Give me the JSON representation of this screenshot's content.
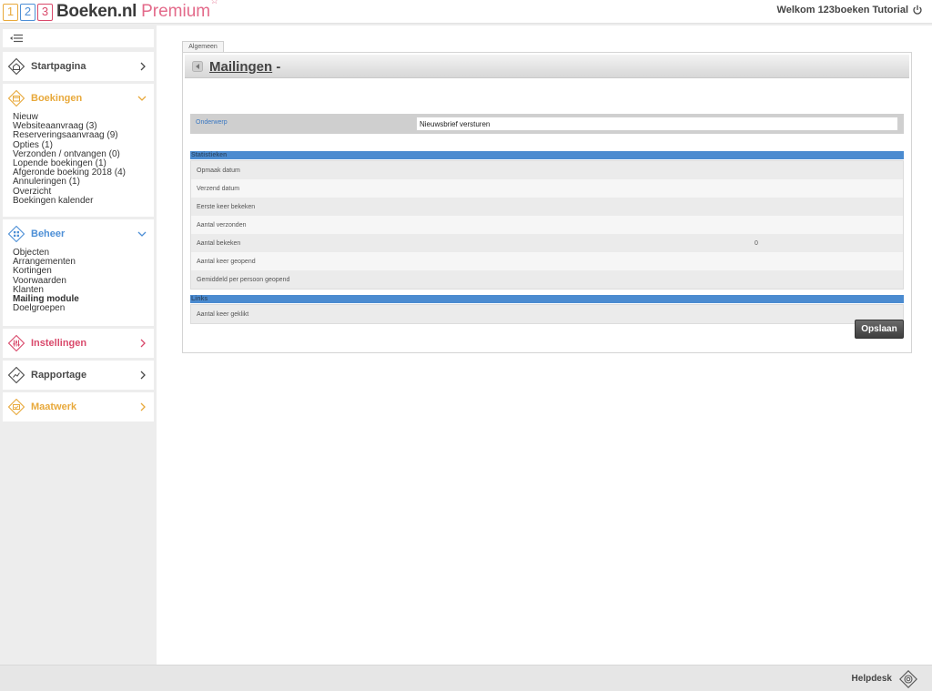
{
  "header": {
    "logo_digits": [
      "1",
      "2",
      "3"
    ],
    "brand": "Boeken.nl",
    "premium": "Premium",
    "premium_star": "☆",
    "welcome": "Welkom 123boeken Tutorial"
  },
  "sidebar": {
    "startpagina": "Startpagina",
    "boekingen": {
      "title": "Boekingen",
      "items": [
        "Nieuw",
        "Websiteaanvraag (3)",
        "Reserveringsaanvraag (9)",
        "Opties (1)",
        "Verzonden / ontvangen (0)",
        "Lopende boekingen (1)",
        "Afgeronde boeking 2018 (4)",
        "Annuleringen (1)",
        "Overzicht",
        "Boekingen kalender"
      ]
    },
    "beheer": {
      "title": "Beheer",
      "items": [
        "Objecten",
        "Arrangementen",
        "Kortingen",
        "Voorwaarden",
        "Klanten",
        "Mailing module",
        "Doelgroepen"
      ],
      "active": "Mailing module"
    },
    "instellingen": "Instellingen",
    "rapportage": "Rapportage",
    "maatwerk": "Maatwerk"
  },
  "main": {
    "tab": "Algemeen",
    "title": "Mailingen",
    "title_suffix": "-",
    "onderwerp_label": "Onderwerp",
    "onderwerp_value": "Nieuwsbrief versturen",
    "stats_header": "Statistieken",
    "stats": [
      {
        "label": "Opmaak datum",
        "value": ""
      },
      {
        "label": "Verzend datum",
        "value": ""
      },
      {
        "label": "Eerste keer bekeken",
        "value": ""
      },
      {
        "label": "Aantal verzonden",
        "value": ""
      },
      {
        "label": "Aantal bekeken",
        "value": "0"
      },
      {
        "label": "Aantal keer geopend",
        "value": ""
      },
      {
        "label": "Gemiddeld per persoon geopend",
        "value": ""
      }
    ],
    "links_header": "Links",
    "links": [
      {
        "label": "Aantal keer geklikt",
        "value": ""
      }
    ],
    "save_label": "Opslaan"
  },
  "footer": {
    "helpdesk": "Helpdesk"
  },
  "colors": {
    "startpagina": "#4a4a4a",
    "boekingen": "#e8a93b",
    "beheer": "#4d8fd6",
    "instellingen": "#d9496b",
    "rapportage": "#4a4a4a",
    "maatwerk": "#e8a93b",
    "section": "#4b8bd0"
  }
}
